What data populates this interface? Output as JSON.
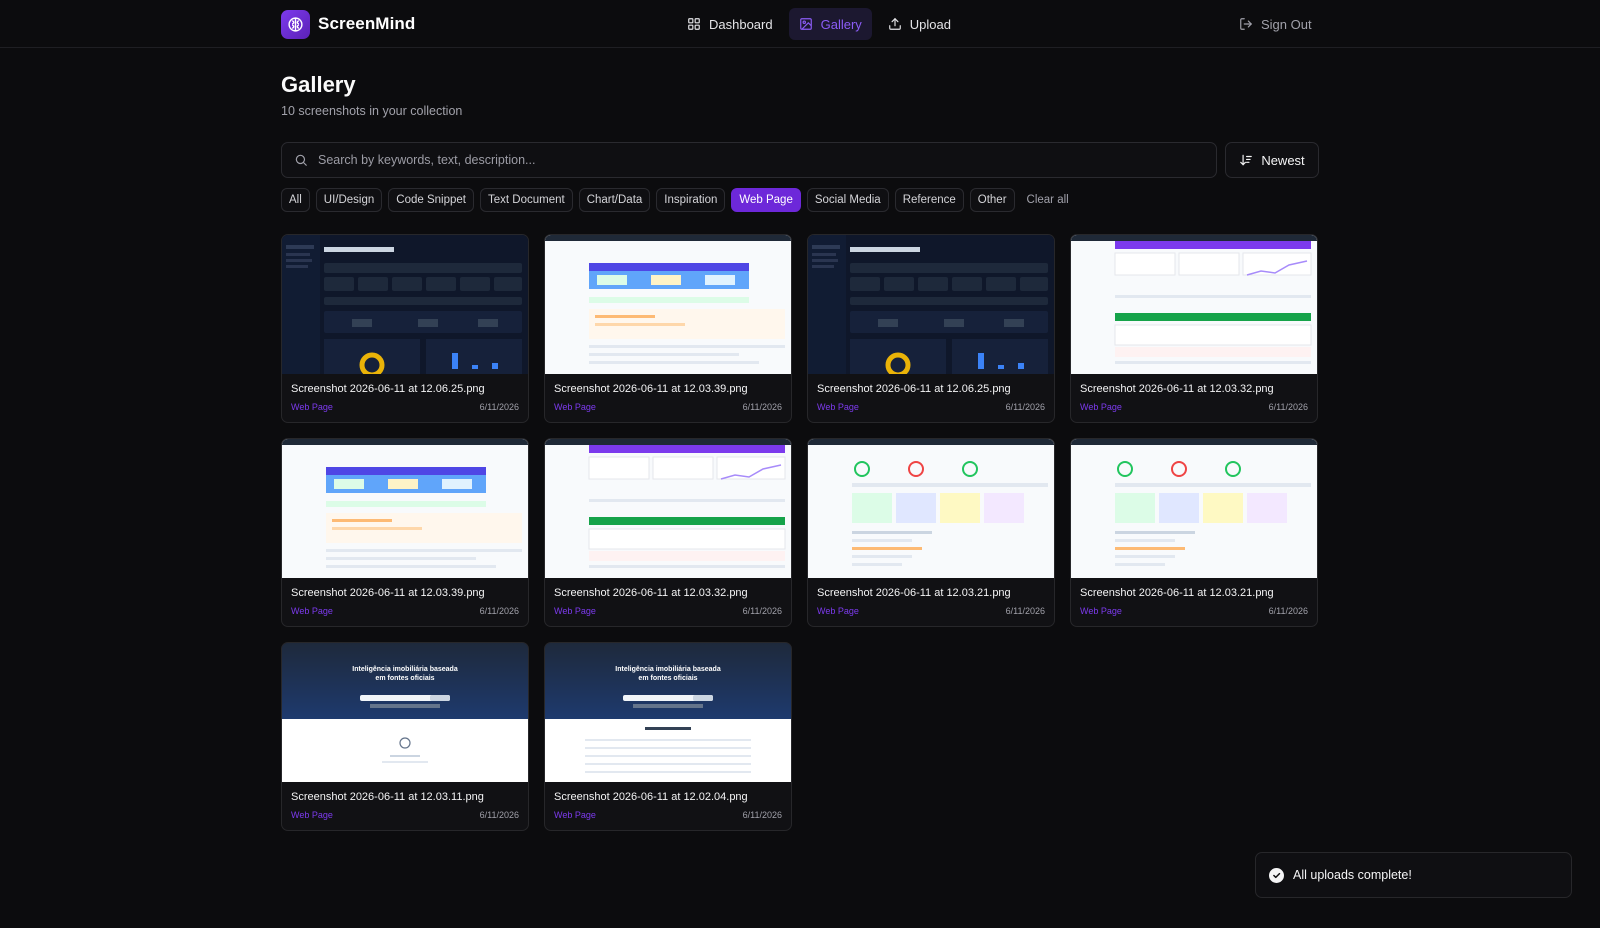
{
  "app": {
    "name": "ScreenMind"
  },
  "nav": {
    "items": [
      {
        "label": "Dashboard",
        "icon": "dashboard-icon",
        "active": false
      },
      {
        "label": "Gallery",
        "icon": "image-icon",
        "active": true
      },
      {
        "label": "Upload",
        "icon": "upload-icon",
        "active": false
      }
    ],
    "sign_out": "Sign Out"
  },
  "page": {
    "title": "Gallery",
    "subtitle": "10 screenshots in your collection"
  },
  "search": {
    "placeholder": "Search by keywords, text, description..."
  },
  "sort": {
    "label": "Newest"
  },
  "filters": {
    "chips": [
      {
        "label": "All",
        "active": false
      },
      {
        "label": "UI/Design",
        "active": false
      },
      {
        "label": "Code Snippet",
        "active": false
      },
      {
        "label": "Text Document",
        "active": false
      },
      {
        "label": "Chart/Data",
        "active": false
      },
      {
        "label": "Inspiration",
        "active": false
      },
      {
        "label": "Web Page",
        "active": true
      },
      {
        "label": "Social Media",
        "active": false
      },
      {
        "label": "Reference",
        "active": false
      },
      {
        "label": "Other",
        "active": false
      }
    ],
    "clear_label": "Clear all"
  },
  "cards": [
    {
      "name": "Screenshot 2026-06-11 at 12.06.25.png",
      "tag": "Web Page",
      "date": "6/11/2026",
      "thumb": "dark-dashboard"
    },
    {
      "name": "Screenshot 2026-06-11 at 12.03.39.png",
      "tag": "Web Page",
      "date": "6/11/2026",
      "thumb": "light-report"
    },
    {
      "name": "Screenshot 2026-06-11 at 12.06.25.png",
      "tag": "Web Page",
      "date": "6/11/2026",
      "thumb": "dark-dashboard"
    },
    {
      "name": "Screenshot 2026-06-11 at 12.03.32.png",
      "tag": "Web Page",
      "date": "6/11/2026",
      "thumb": "light-stats"
    },
    {
      "name": "Screenshot 2026-06-11 at 12.03.39.png",
      "tag": "Web Page",
      "date": "6/11/2026",
      "thumb": "light-report"
    },
    {
      "name": "Screenshot 2026-06-11 at 12.03.32.png",
      "tag": "Web Page",
      "date": "6/11/2026",
      "thumb": "light-stats"
    },
    {
      "name": "Screenshot 2026-06-11 at 12.03.21.png",
      "tag": "Web Page",
      "date": "6/11/2026",
      "thumb": "light-scores"
    },
    {
      "name": "Screenshot 2026-06-11 at 12.03.21.png",
      "tag": "Web Page",
      "date": "6/11/2026",
      "thumb": "light-scores"
    },
    {
      "name": "Screenshot 2026-06-11 at 12.03.11.png",
      "tag": "Web Page",
      "date": "6/11/2026",
      "thumb": "hero-loading"
    },
    {
      "name": "Screenshot 2026-06-11 at 12.02.04.png",
      "tag": "Web Page",
      "date": "6/11/2026",
      "thumb": "hero-table"
    }
  ],
  "thumb_text": {
    "hero_line1": "Inteligência imobiliária baseada",
    "hero_line2": "em fontes oficiais"
  },
  "toast": {
    "message": "All uploads complete!"
  },
  "colors": {
    "accent": "#6d28d9",
    "background": "#0c0c0e",
    "tag": "#7c3aed"
  }
}
